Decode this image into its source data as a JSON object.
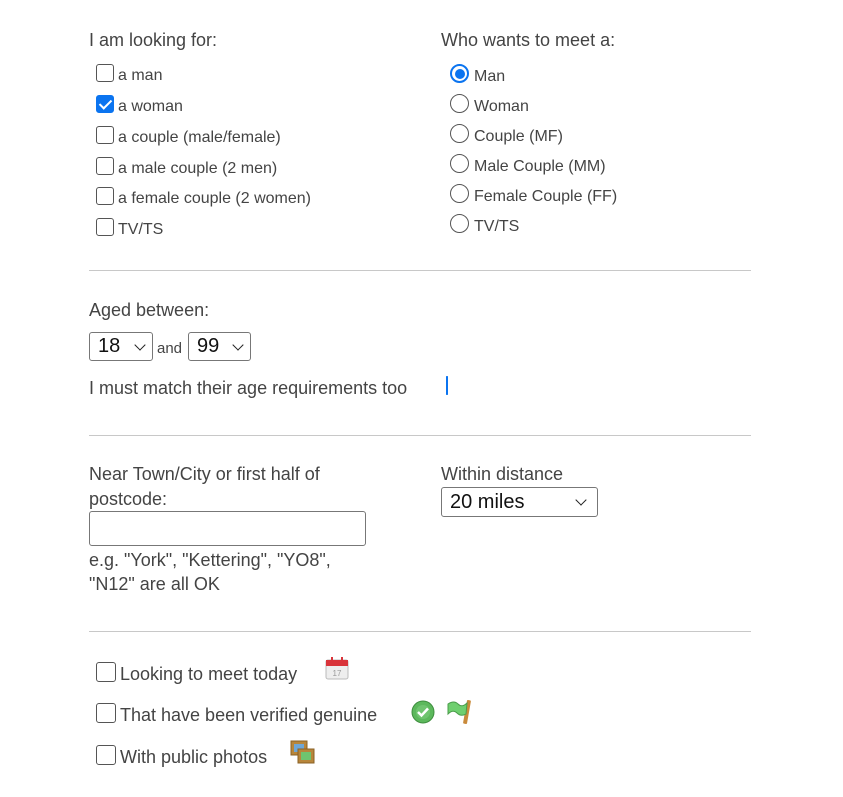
{
  "looking_for": {
    "heading": "I am looking for:",
    "options": [
      {
        "label": "a man",
        "checked": false
      },
      {
        "label": "a woman",
        "checked": true
      },
      {
        "label": "a couple (male/female)",
        "checked": false
      },
      {
        "label": "a male couple (2 men)",
        "checked": false
      },
      {
        "label": "a female couple (2 women)",
        "checked": false
      },
      {
        "label": "TV/TS",
        "checked": false
      }
    ]
  },
  "who_wants": {
    "heading": "Who wants to meet a:",
    "options": [
      {
        "label": "Man",
        "selected": true
      },
      {
        "label": "Woman",
        "selected": false
      },
      {
        "label": "Couple (MF)",
        "selected": false
      },
      {
        "label": "Male Couple (MM)",
        "selected": false
      },
      {
        "label": "Female Couple (FF)",
        "selected": false
      },
      {
        "label": "TV/TS",
        "selected": false
      }
    ]
  },
  "age": {
    "heading": "Aged between:",
    "min_value": "18",
    "and_label": "and",
    "max_value": "99",
    "match_label": "I must match their age requirements too",
    "match_checked": true
  },
  "location": {
    "label_line1": "Near Town/City or first half of",
    "label_line2": "postcode:",
    "input_value": "",
    "hint_line1": "e.g. \"York\", \"Kettering\", \"YO8\",",
    "hint_line2": "\"N12\" are all OK",
    "distance_label": "Within distance",
    "distance_value": "20 miles"
  },
  "extras": [
    {
      "label": "Looking to meet today",
      "checked": false,
      "icons": [
        "calendar-icon"
      ]
    },
    {
      "label": "That have been verified genuine",
      "checked": false,
      "icons": [
        "verified-check-icon",
        "flag-icon"
      ]
    },
    {
      "label": "With public photos",
      "checked": false,
      "icons": [
        "photos-icon"
      ]
    }
  ],
  "colors": {
    "accent": "#0b74f0",
    "text": "#444444",
    "divider": "#c8c8c8"
  }
}
